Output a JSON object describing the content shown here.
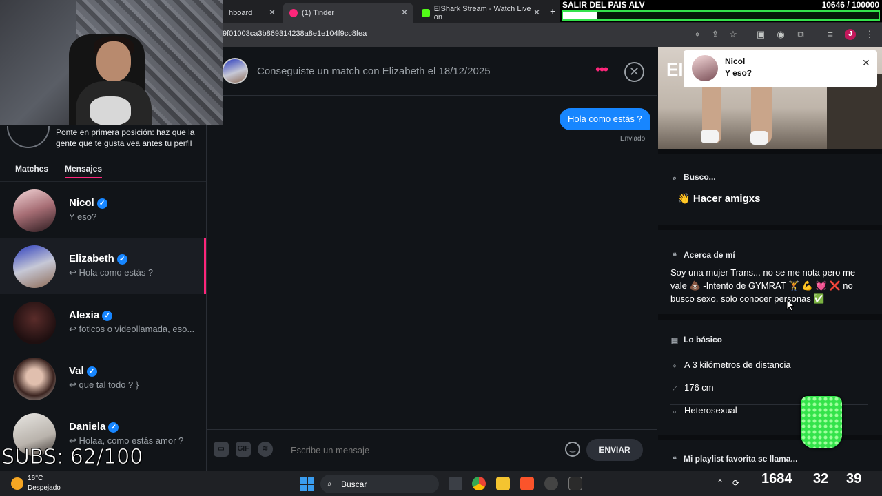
{
  "browser": {
    "tabs": [
      {
        "label": "hboard"
      },
      {
        "label": "(1) Tinder",
        "color": "#fd267a"
      },
      {
        "label": "ElShark Stream - Watch Live on",
        "color": "#53fc18"
      }
    ],
    "url": "9f01003ca3b869314238a8e1e104f9cc8fea",
    "profile_initial": "J"
  },
  "stream_goal": {
    "title": "SALIR DEL PAIS ALV",
    "count": "10646  / 100000",
    "progress": 0.1065
  },
  "subs": "SUBS: 62/100",
  "sidebar": {
    "boost_text": "Ponte en primera posición: haz que la gente que te gusta vea antes tu perfil",
    "tabs": [
      "Matches",
      "Mensajes"
    ],
    "conversations": [
      {
        "name": "Nicol",
        "message": "Y eso?",
        "reply": false
      },
      {
        "name": "Elizabeth",
        "message": "↩ Hola como estás ?",
        "reply": true
      },
      {
        "name": "Alexia",
        "message": "↩ foticos o videollamada, eso...",
        "reply": true
      },
      {
        "name": "Val",
        "message": "↩ que tal todo ? }",
        "reply": true
      },
      {
        "name": "Daniela",
        "message": "↩ Holaa, como estás amor ?",
        "reply": true
      }
    ]
  },
  "chat": {
    "header": "Conseguiste un match con Elizabeth el 18/12/2025",
    "message": "Hola como estás ?",
    "status": "Enviado",
    "placeholder": "Escribe un mensaje",
    "send": "ENVIAR",
    "gif": "GIF"
  },
  "profile": {
    "name_partial": "El",
    "notification": {
      "name": "Nicol",
      "message": "Y eso?"
    },
    "looking_title": "Busco...",
    "looking_value": "Hacer amigxs",
    "about_title": "Acerca de mí",
    "about_text": "Soy una mujer Trans... no se me nota pero me vale 💩 -Intento de GYMRAT 🏋 💪 💓 ❌ no busco sexo, solo conocer personas ✅",
    "basics_title": "Lo básico",
    "basics": [
      "A 3 kilómetros de distancia",
      "176 cm",
      "Heterosexual"
    ],
    "playlist_title": "Mi playlist favorita se llama..."
  },
  "taskbar": {
    "temp": "16°C",
    "weather": "Despejado",
    "search": "Buscar",
    "overlay_a": "1684",
    "overlay_b": "32",
    "overlay_c": "39"
  }
}
